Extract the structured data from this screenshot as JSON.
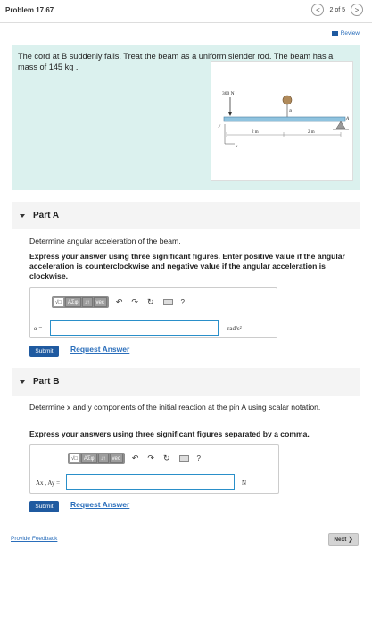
{
  "header": {
    "title": "Problem 17.67",
    "pager_text": "2 of 5",
    "prev_glyph": "<",
    "next_glyph": ">"
  },
  "review_label": "Review",
  "intro": {
    "text": "The cord at B suddenly fails. Treat the beam as a uniform slender rod. The beam has a mass of 145 kg .",
    "figure": {
      "force_label": "300 N",
      "point_b": "B",
      "point_a": "A",
      "dim_1": "2 m",
      "dim_2": "2 m",
      "axis_y": "y",
      "axis_x": "x"
    }
  },
  "part_a": {
    "label": "Part A",
    "question": "Determine angular acceleration of the beam.",
    "instructions": "Express your answer using three significant figures. Enter positive value if the angular acceleration is counterclockwise and negative value if the angular acceleration is clockwise.",
    "toolbar": {
      "templates": "√□",
      "greek": "AΣφ",
      "arrows": "↓↑",
      "vec": "vec",
      "help": "?"
    },
    "answer_label": "α =",
    "answer_value": "",
    "unit": "rad/s²",
    "submit_label": "Submit",
    "request_label": "Request Answer"
  },
  "part_b": {
    "label": "Part B",
    "question": "Determine x and y components of the initial reaction at the pin A using scalar notation.",
    "instructions": "Express your answers using three significant figures separated by a comma.",
    "toolbar": {
      "templates": "√□",
      "greek": "AΣφ",
      "arrows": "↓↑",
      "vec": "vec",
      "help": "?"
    },
    "answer_label": "Ax , Ay =",
    "answer_value": "",
    "unit": "N",
    "submit_label": "Submit",
    "request_label": "Request Answer"
  },
  "footer": {
    "feedback_label": "Provide Feedback",
    "next_label": "Next ❯"
  }
}
